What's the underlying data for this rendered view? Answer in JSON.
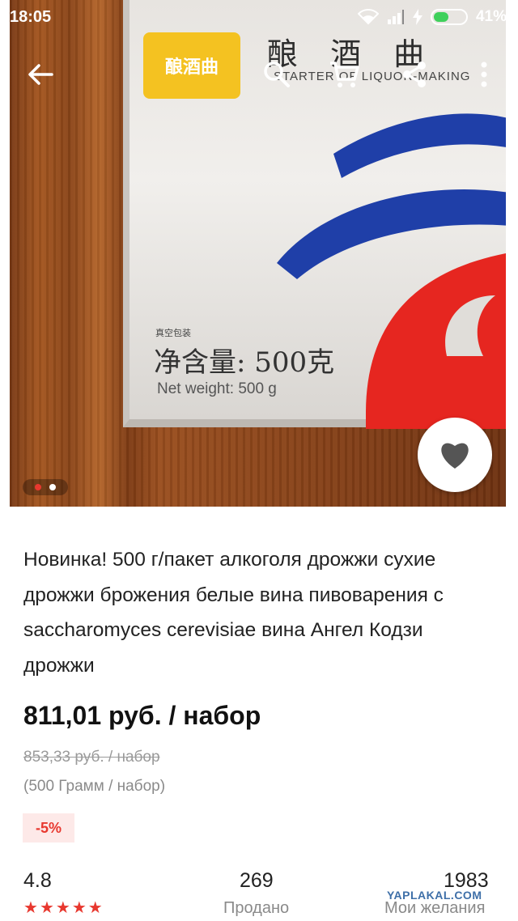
{
  "status_bar": {
    "time": "18:05",
    "battery": "41%"
  },
  "image": {
    "logo_text": "酿酒曲",
    "package_cn_title": "酿 酒 曲",
    "package_en_title": "STARTER OF LIQUOR-MAKING",
    "net_label_small": "真空包装",
    "net_cn": "净含量: 500克",
    "net_en": "Net weight: 500 g",
    "slides_total": 2,
    "active_slide": 1
  },
  "toolbar": {
    "back_icon": "arrow-left-icon",
    "search_icon": "search-icon",
    "cart_icon": "cart-icon",
    "share_icon": "share-icon",
    "more_icon": "more-vertical-icon"
  },
  "product": {
    "title": "Новинка! 500 г/пакет алкоголя дрожжи сухие дрожжи брожения белые вина пивоварения с saccharomyces cerevisiae вина Ангел Кодзи дрожжи",
    "price": "811,01 руб. / набор",
    "old_price": "853,33 руб. / набор",
    "unit": "(500 Грамм / набор)",
    "discount": "-5%"
  },
  "stats": {
    "rating": "4.8",
    "rating_stars": 5,
    "sold_count": "269",
    "sold_label": "Продано",
    "wish_count": "1983",
    "wish_label": "Мои желания"
  },
  "watermark": "YAPLAKAL.COM",
  "colors": {
    "accent": "#e8382f",
    "logo_yellow": "#f4c221",
    "swirl_blue": "#1f3fa8",
    "swirl_red": "#e62620",
    "battery_green": "#3fd05b"
  }
}
